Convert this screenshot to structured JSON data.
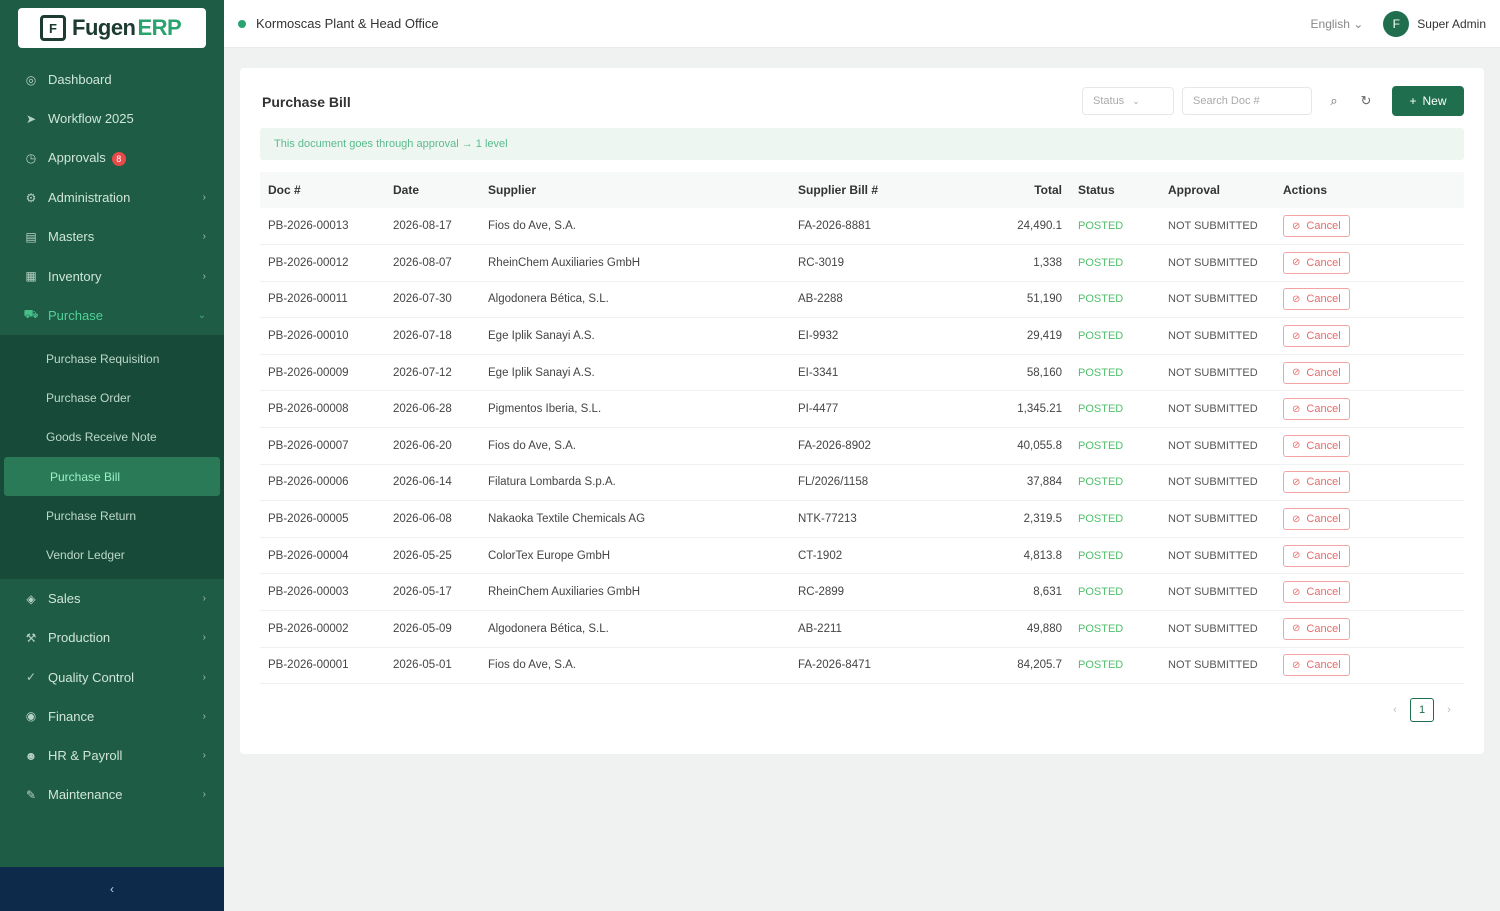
{
  "app": {
    "logo_text": "Fugen",
    "logo_accent": "ERP",
    "logo_mark": "F"
  },
  "sidebar": {
    "items": [
      {
        "label": "Dashboard",
        "icon": "dashboard-icon",
        "glyph": "◎",
        "has_children": false
      },
      {
        "label": "Workflow 2025",
        "icon": "workflow-icon",
        "glyph": "➤",
        "has_children": false
      },
      {
        "label": "Approvals",
        "icon": "approvals-icon",
        "glyph": "◷",
        "has_children": false,
        "badge": "8"
      },
      {
        "label": "Administration",
        "icon": "admin-icon",
        "glyph": "⚙",
        "has_children": true
      },
      {
        "label": "Masters",
        "icon": "masters-icon",
        "glyph": "▤",
        "has_children": true
      },
      {
        "label": "Inventory",
        "icon": "inventory-icon",
        "glyph": "▦",
        "has_children": true
      },
      {
        "label": "Purchase",
        "icon": "purchase-icon",
        "glyph": "⛟",
        "has_children": true,
        "expanded": true
      }
    ],
    "purchase_sub": [
      {
        "label": "Purchase Requisition",
        "active": false
      },
      {
        "label": "Purchase Order",
        "active": false
      },
      {
        "label": "Goods Receive Note",
        "active": false
      },
      {
        "label": "Purchase Bill",
        "active": true
      },
      {
        "label": "Purchase Return",
        "active": false
      },
      {
        "label": "Vendor Ledger",
        "active": false
      }
    ],
    "items_after": [
      {
        "label": "Sales",
        "icon": "sales-icon",
        "glyph": "◈",
        "has_children": true
      },
      {
        "label": "Production",
        "icon": "production-icon",
        "glyph": "⚒",
        "has_children": true
      },
      {
        "label": "Quality Control",
        "icon": "quality-icon",
        "glyph": "✓",
        "has_children": true
      },
      {
        "label": "Finance",
        "icon": "finance-icon",
        "glyph": "◉",
        "has_children": true
      },
      {
        "label": "HR & Payroll",
        "icon": "hr-icon",
        "glyph": "☻",
        "has_children": true
      },
      {
        "label": "Maintenance",
        "icon": "maintenance-icon",
        "glyph": "✎",
        "has_children": true
      }
    ],
    "collapse_glyph": "‹"
  },
  "header": {
    "company": "Kormoscas Plant & Head Office",
    "language": "English",
    "avatar_initial": "F",
    "user_name": "Super Admin"
  },
  "page": {
    "title": "Purchase Bill",
    "status_placeholder": "Status",
    "search_placeholder": "Search Doc #",
    "new_button": "New",
    "notice": "This document goes through approval → 1 level"
  },
  "table": {
    "headers": [
      "Doc #",
      "Date",
      "Supplier",
      "Supplier Bill #",
      "Total",
      "Status",
      "Approval",
      "Actions"
    ],
    "rows": [
      {
        "doc": "PB-2026-00013",
        "date": "2026-08-17",
        "supplier": "Fios do Ave, S.A.",
        "bill": "FA-2026-8881",
        "total": "24,490.1",
        "status": "POSTED",
        "approval": "NOT SUBMITTED",
        "action": "Cancel"
      },
      {
        "doc": "PB-2026-00012",
        "date": "2026-08-07",
        "supplier": "RheinChem Auxiliaries GmbH",
        "bill": "RC-3019",
        "total": "1,338",
        "status": "POSTED",
        "approval": "NOT SUBMITTED",
        "action": "Cancel"
      },
      {
        "doc": "PB-2026-00011",
        "date": "2026-07-30",
        "supplier": "Algodonera Bética, S.L.",
        "bill": "AB-2288",
        "total": "51,190",
        "status": "POSTED",
        "approval": "NOT SUBMITTED",
        "action": "Cancel"
      },
      {
        "doc": "PB-2026-00010",
        "date": "2026-07-18",
        "supplier": "Ege Iplik Sanayi A.S.",
        "bill": "EI-9932",
        "total": "29,419",
        "status": "POSTED",
        "approval": "NOT SUBMITTED",
        "action": "Cancel"
      },
      {
        "doc": "PB-2026-00009",
        "date": "2026-07-12",
        "supplier": "Ege Iplik Sanayi A.S.",
        "bill": "EI-3341",
        "total": "58,160",
        "status": "POSTED",
        "approval": "NOT SUBMITTED",
        "action": "Cancel"
      },
      {
        "doc": "PB-2026-00008",
        "date": "2026-06-28",
        "supplier": "Pigmentos Iberia, S.L.",
        "bill": "PI-4477",
        "total": "1,345.21",
        "status": "POSTED",
        "approval": "NOT SUBMITTED",
        "action": "Cancel"
      },
      {
        "doc": "PB-2026-00007",
        "date": "2026-06-20",
        "supplier": "Fios do Ave, S.A.",
        "bill": "FA-2026-8902",
        "total": "40,055.8",
        "status": "POSTED",
        "approval": "NOT SUBMITTED",
        "action": "Cancel"
      },
      {
        "doc": "PB-2026-00006",
        "date": "2026-06-14",
        "supplier": "Filatura Lombarda S.p.A.",
        "bill": "FL/2026/1158",
        "total": "37,884",
        "status": "POSTED",
        "approval": "NOT SUBMITTED",
        "action": "Cancel"
      },
      {
        "doc": "PB-2026-00005",
        "date": "2026-06-08",
        "supplier": "Nakaoka Textile Chemicals AG",
        "bill": "NTK-77213",
        "total": "2,319.5",
        "status": "POSTED",
        "approval": "NOT SUBMITTED",
        "action": "Cancel"
      },
      {
        "doc": "PB-2026-00004",
        "date": "2026-05-25",
        "supplier": "ColorTex Europe GmbH",
        "bill": "CT-1902",
        "total": "4,813.8",
        "status": "POSTED",
        "approval": "NOT SUBMITTED",
        "action": "Cancel"
      },
      {
        "doc": "PB-2026-00003",
        "date": "2026-05-17",
        "supplier": "RheinChem Auxiliaries GmbH",
        "bill": "RC-2899",
        "total": "8,631",
        "status": "POSTED",
        "approval": "NOT SUBMITTED",
        "action": "Cancel"
      },
      {
        "doc": "PB-2026-00002",
        "date": "2026-05-09",
        "supplier": "Algodonera Bética, S.L.",
        "bill": "AB-2211",
        "total": "49,880",
        "status": "POSTED",
        "approval": "NOT SUBMITTED",
        "action": "Cancel"
      },
      {
        "doc": "PB-2026-00001",
        "date": "2026-05-01",
        "supplier": "Fios do Ave, S.A.",
        "bill": "FA-2026-8471",
        "total": "84,205.7",
        "status": "POSTED",
        "approval": "NOT SUBMITTED",
        "action": "Cancel"
      }
    ]
  },
  "pagination": {
    "current_page": "1",
    "prev_glyph": "‹",
    "next_glyph": "›"
  },
  "colors": {
    "sidebar_bg": "#1f5c45",
    "accent": "#1f6f4f",
    "posted": "#4fbf6a",
    "cancel": "#e76b6b"
  }
}
